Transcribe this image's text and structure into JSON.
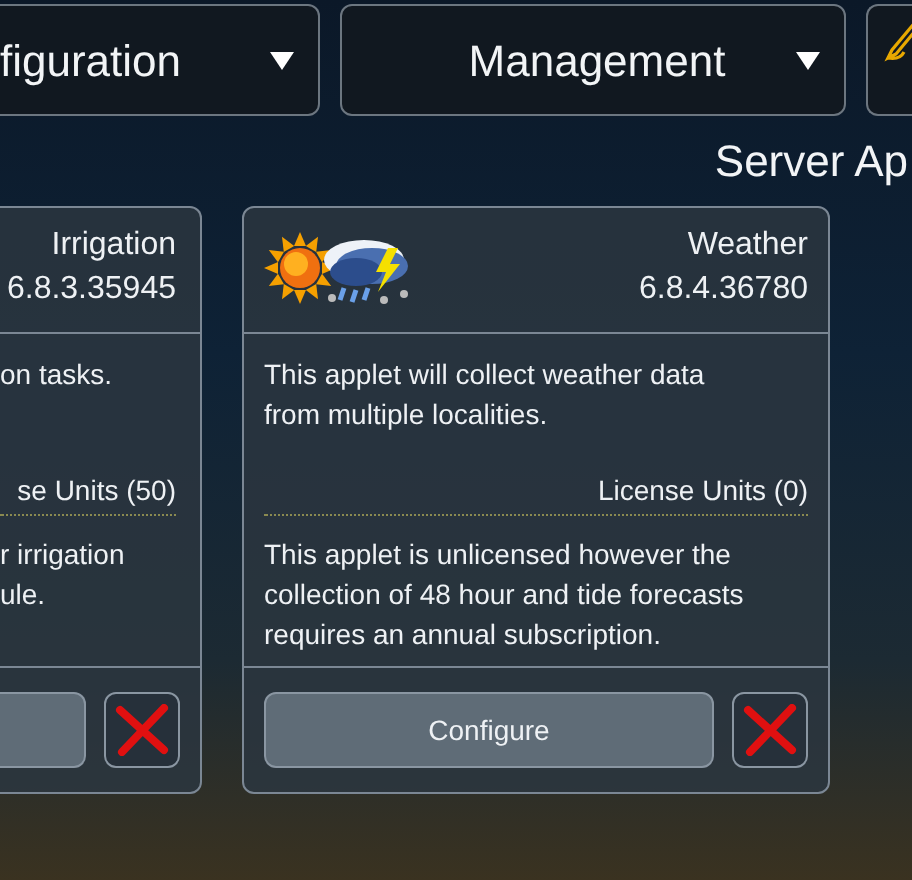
{
  "menus": [
    {
      "label": "figuration"
    },
    {
      "label": "Management"
    }
  ],
  "page_title": "Server Ap",
  "applets": [
    {
      "name": "Irrigation",
      "version": "6.8.3.35945",
      "description": "on tasks.",
      "license_units": "se Units (50)",
      "note_lines": [
        "r irrigation",
        "ule."
      ]
    },
    {
      "name": "Weather",
      "version": "6.8.4.36780",
      "description": "This applet will collect weather data from multiple localities.",
      "license_units": "License Units (0)",
      "note_lines": [
        "This applet is unlicensed however the collection of 48 hour and tide forecasts requires an annual subscription."
      ],
      "configure": "Configure"
    }
  ]
}
